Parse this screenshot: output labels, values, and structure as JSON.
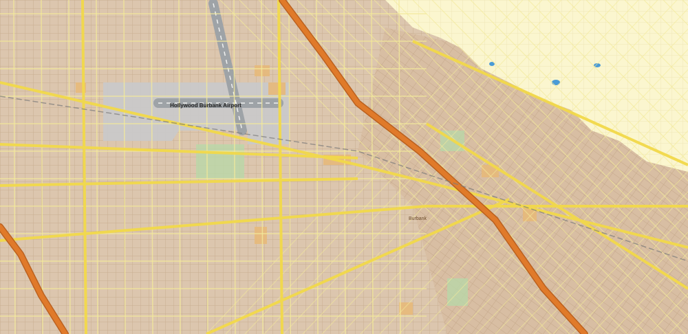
{
  "map": {
    "labels": {
      "airport": "Hollywood Burbank Airport",
      "city": "Burbank"
    },
    "colors": {
      "urban_fill": "#dcc6ae",
      "urban_grid": "#c8ad90",
      "street": "#f3ea9b",
      "major_road": "#f2d94a",
      "freeway": "#e07a2a",
      "freeway_outline": "#b85c18",
      "hills": "#fbf6cf",
      "hill_grid": "#efe6b7",
      "airport_area": "#c9c9c9",
      "runway": "#9ea3a7",
      "park": "#b9d7a7",
      "water": "#4a9bd6",
      "commercial": "#e7b97a"
    }
  }
}
